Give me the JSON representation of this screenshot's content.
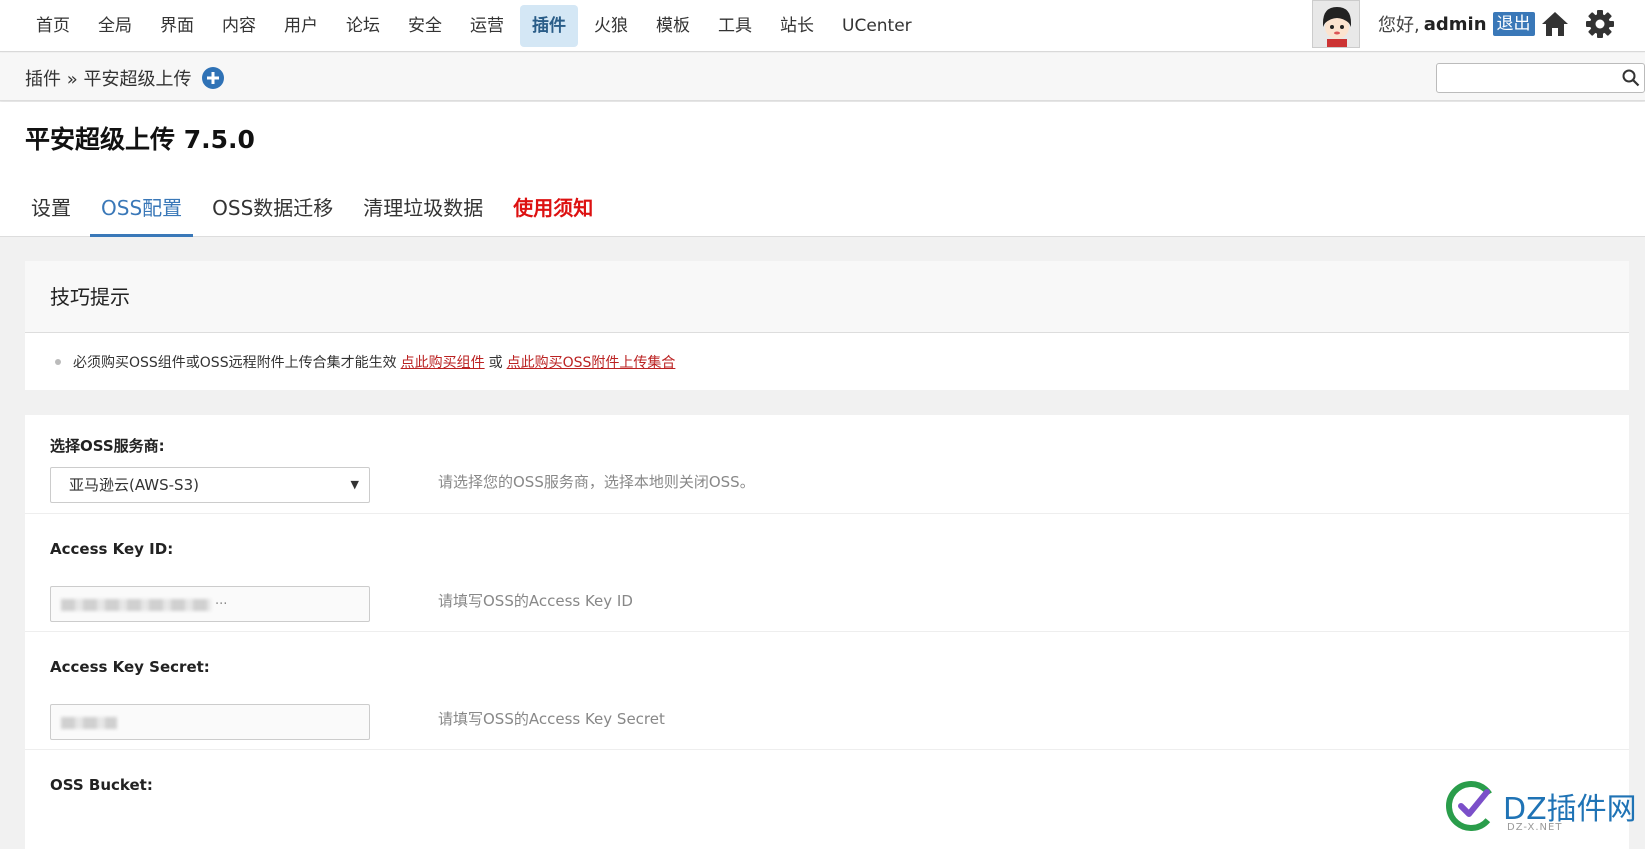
{
  "topnav": {
    "items": [
      "首页",
      "全局",
      "界面",
      "内容",
      "用户",
      "论坛",
      "安全",
      "运营",
      "插件",
      "火狼",
      "模板",
      "工具",
      "站长",
      "UCenter"
    ],
    "active_index": 8,
    "greeting": "您好,",
    "username": "admin",
    "logout_label": "退出",
    "icons": {
      "home": "home-icon",
      "settings": "gear-icon"
    }
  },
  "breadcrumb": {
    "text": "插件 » 平安超级上传",
    "add_icon": "plus-circle-icon"
  },
  "search": {
    "placeholder": "",
    "icon": "search-icon"
  },
  "page": {
    "title": "平安超级上传 7.5.0",
    "tabs": [
      {
        "label": "设置",
        "state": "normal"
      },
      {
        "label": "OSS配置",
        "state": "active"
      },
      {
        "label": "OSS数据迁移",
        "state": "normal"
      },
      {
        "label": "清理垃圾数据",
        "state": "normal"
      },
      {
        "label": "使用须知",
        "state": "warning"
      }
    ]
  },
  "tips": {
    "title": "技巧提示",
    "text": "必须购买OSS组件或OSS远程附件上传合集才能生效",
    "link1": "点此购买组件",
    "or": "或",
    "link2": "点此购买OSS附件上传集合"
  },
  "form": {
    "provider": {
      "label": "选择OSS服务商:",
      "value": "亚马逊云(AWS-S3)",
      "hint": "请选择您的OSS服务商，选择本地则关闭OSS。"
    },
    "access_key_id": {
      "label": "Access Key ID:",
      "value_visible": "...",
      "hint": "请填写OSS的Access Key ID"
    },
    "access_key_secret": {
      "label": "Access Key Secret:",
      "hint": "请填写OSS的Access Key Secret"
    },
    "bucket": {
      "label": "OSS Bucket:"
    }
  },
  "watermark": {
    "text": "DZ插件网",
    "sub": "DZ-X.NET"
  },
  "colors": {
    "accent": "#3a78b8",
    "warning": "#dd1111",
    "link": "#bb2222",
    "active_nav_bg": "#d4e7f5"
  }
}
